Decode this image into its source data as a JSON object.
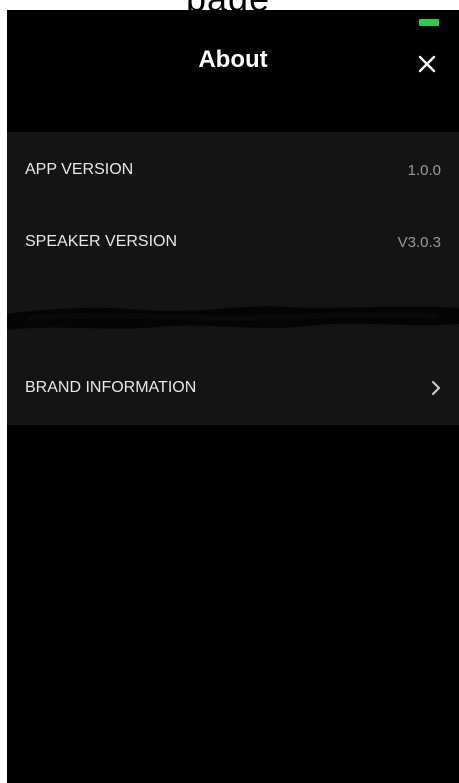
{
  "page_fragment": "page",
  "header": {
    "title": "About"
  },
  "rows": {
    "app_version": {
      "label": "APP VERSION",
      "value": "1.0.0"
    },
    "speaker_version": {
      "label": "SPEAKER VERSION",
      "value": "V3.0.3"
    },
    "brand_information": {
      "label": "BRAND INFORMATION"
    }
  },
  "icons": {
    "close": "close-icon",
    "chevron": "chevron-right-icon"
  },
  "colors": {
    "background": "#000000",
    "panel": "#141414",
    "battery": "#2ecc40",
    "text_primary": "#e8e8e8",
    "text_secondary": "#9a9a9a"
  }
}
